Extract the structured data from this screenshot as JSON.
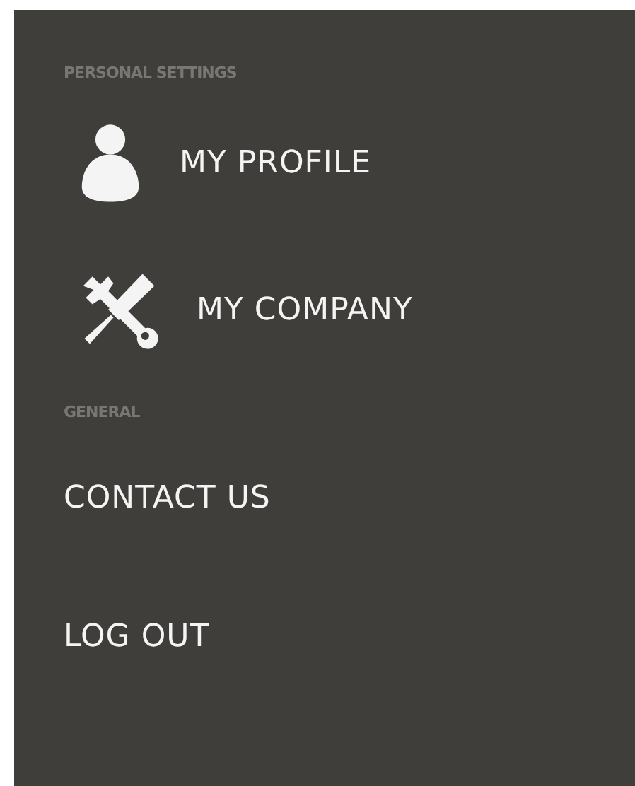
{
  "sections": [
    {
      "heading": "PERSONAL SETTINGS",
      "items": [
        {
          "label": "MY PROFILE",
          "kind": "person"
        },
        {
          "label": "MY COMPANY",
          "kind": "tools"
        }
      ]
    },
    {
      "heading": "GENERAL",
      "items": [
        {
          "label": "CONTACT US",
          "kind": "plain"
        },
        {
          "label": "LOG OUT",
          "kind": "plain"
        }
      ]
    }
  ]
}
